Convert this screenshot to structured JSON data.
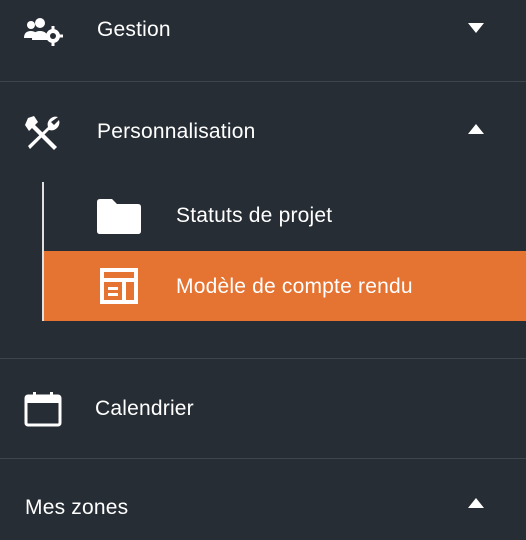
{
  "colors": {
    "background": "#262d34",
    "divider": "#3d454d",
    "active": "#e57331",
    "text": "#ffffff"
  },
  "menu": {
    "gestion": {
      "label": "Gestion",
      "icon": "users-gear-icon",
      "chevron": "chevron-down-icon"
    },
    "personnalisation": {
      "label": "Personnalisation",
      "icon": "tools-icon",
      "chevron": "chevron-up-icon",
      "children": [
        {
          "label": "Statuts de projet",
          "icon": "folder-icon",
          "active": false
        },
        {
          "label": "Modèle de compte rendu",
          "icon": "report-template-icon",
          "active": true
        }
      ]
    },
    "calendrier": {
      "label": "Calendrier",
      "icon": "calendar-icon"
    },
    "mes_zones": {
      "label": "Mes zones",
      "chevron": "chevron-up-icon"
    }
  }
}
